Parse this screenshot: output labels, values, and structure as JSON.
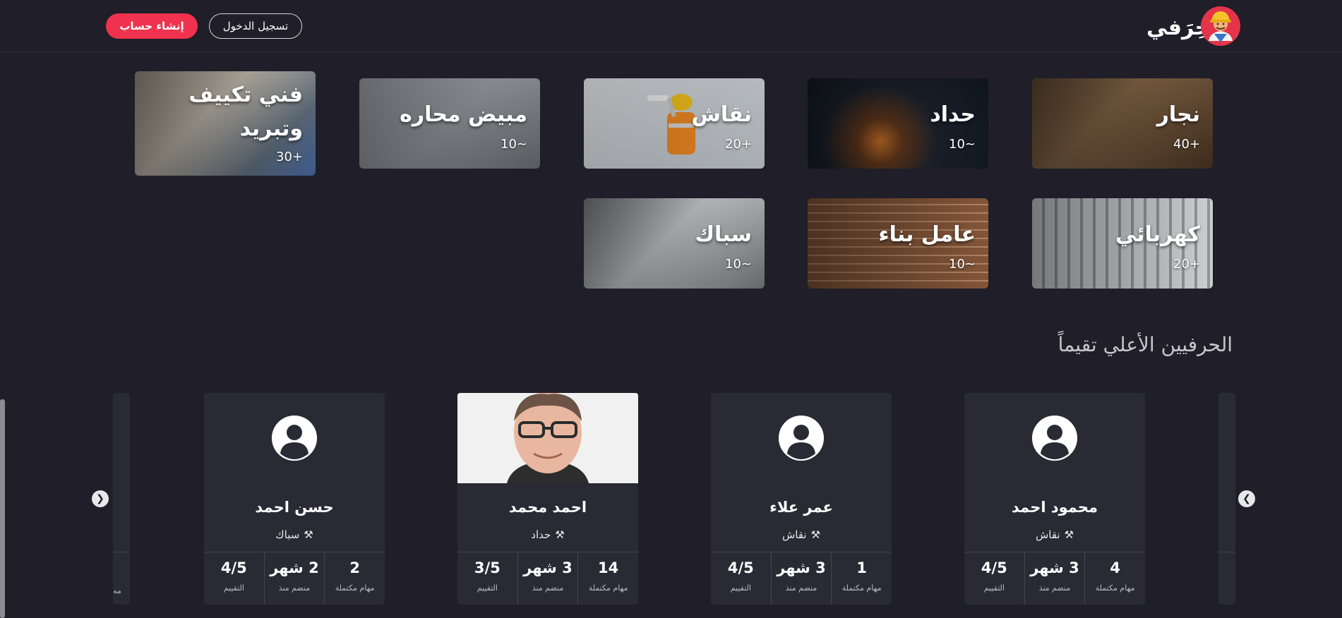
{
  "header": {
    "brand_name": "حِرَفي",
    "login_label": "تسجيل الدخول",
    "signup_label": "إنشاء حساب"
  },
  "crafts": [
    {
      "name": "نجار",
      "count": "40+"
    },
    {
      "name": "حداد",
      "count": "10~"
    },
    {
      "name": "نقاش",
      "count": "20+"
    },
    {
      "name": "مبيض محاره",
      "count": "10~"
    },
    {
      "name": "فني تكييف وتبريد",
      "count": "30+"
    },
    {
      "name": "كهربائي",
      "count": "20+"
    },
    {
      "name": "عامل بناء",
      "count": "10~"
    },
    {
      "name": "سباك",
      "count": "10~"
    }
  ],
  "top_section_title": "الحرفيين الأعلي تقيماً",
  "stat_labels": {
    "completed": "مهام مكتملة",
    "since": "منضم منذ",
    "rating": "التقييم"
  },
  "workers": [
    {
      "name": "محمود احمد",
      "craft": "نقاش",
      "completed": "4",
      "since": "3 شهر",
      "rating": "4/5"
    },
    {
      "name": "عمر علاء",
      "craft": "نقاش",
      "completed": "1",
      "since": "3 شهر",
      "rating": "4/5"
    },
    {
      "name": "احمد محمد",
      "craft": "حداد",
      "completed": "14",
      "since": "3 شهر",
      "rating": "3/5"
    },
    {
      "name": "حسن احمد",
      "craft": "سباك",
      "completed": "2",
      "since": "2 شهر",
      "rating": "4/5"
    }
  ],
  "edge_label": "مه",
  "colors": {
    "background": "#1f1e29",
    "accent": "#f0324e",
    "card": "#2a2a35"
  }
}
